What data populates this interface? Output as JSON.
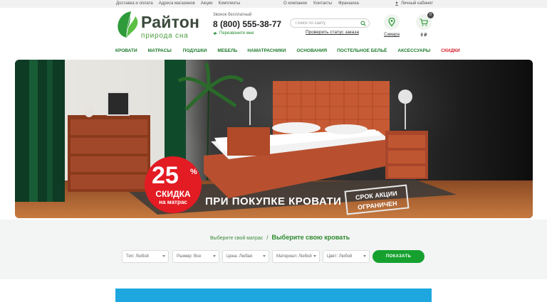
{
  "topbar": {
    "left_links": [
      "Доставка и оплата",
      "Адреса магазинов",
      "Акции",
      "Комплекты"
    ],
    "mid_links": [
      "О компании",
      "Контакты",
      "Франшиза"
    ],
    "account_label": "Личный кабинет"
  },
  "header": {
    "logo_name": "Райтон",
    "logo_tagline": "природа сна",
    "phone_label": "Звонок бесплатный",
    "phone_number": "8 (800) 555-38-77",
    "callback_label": "Перезвоните мне",
    "search_placeholder": "Поиск по сайту",
    "order_status_link": "Проверить статус заказа",
    "city": "Самара",
    "cart_count": "0",
    "cart_sum": "0 ₽"
  },
  "nav": {
    "items": [
      "КРОВАТИ",
      "МАТРАСЫ",
      "ПОДУШКИ",
      "МЕБЕЛЬ",
      "НАМАТРАСНИКИ",
      "ОСНОВАНИЯ",
      "ПОСТЕЛЬНОЕ БЕЛЬЁ",
      "АКСЕССУАРЫ",
      "СКИДКИ"
    ]
  },
  "banner": {
    "discount_percent": "25",
    "discount_sign": "%",
    "discount_word": "СКИДКА",
    "discount_target": "на матрас",
    "headline": "ПРИ ПОКУПКЕ КРОВАТИ",
    "stamp_line1": "СРОК АКЦИИ",
    "stamp_line2": "ОГРАНИЧЕН"
  },
  "filter": {
    "crumb_inactive": "Выберите свой матрас",
    "separator": "/",
    "crumb_active": "Выберите свою кровать",
    "selects": [
      "Тип: Любой",
      "Размер: Все",
      "Цена: Любая",
      "Материал: Любой",
      "Цвет: Любой"
    ],
    "show_button": "ПОКАЗАТЬ"
  },
  "colors": {
    "brand_green": "#16a12f",
    "nav_green": "#1d7a2c",
    "sale_red": "#d81e2b",
    "promo_blue": "#1ea7df"
  }
}
